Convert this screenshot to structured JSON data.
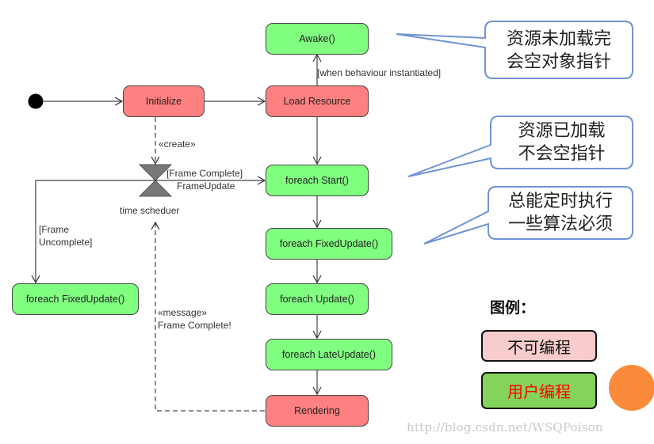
{
  "diagram": {
    "type": "uml-activity",
    "nodes": {
      "awake": "Awake()",
      "load_resource": "Load Resource",
      "initialize": "Initialize",
      "start": "foreach Start()",
      "fixed_update": "foreach FixedUpdate()",
      "update": "foreach Update()",
      "late_update": "foreach LateUpdate()",
      "rendering": "Rendering",
      "fixed_update_loop": "foreach FixedUpdate()"
    },
    "edge_labels": {
      "when_instantiated": "[when behaviour instantiated]",
      "create": "«create»",
      "frame_complete_line1": "[Frame Complete]",
      "frame_complete_line2": "FrameUpdate",
      "frame_uncomplete_line1": "[Frame",
      "frame_uncomplete_line2": "Uncomplete]",
      "message_line1": "«message»",
      "message_line2": "Frame Complete!",
      "time_scheduler": "time scheduer"
    },
    "callouts": [
      {
        "line1": "资源未加载完",
        "line2": "会空对象指针"
      },
      {
        "line1": "资源已加载",
        "line2": "不会空指针"
      },
      {
        "line1": "总能定时执行",
        "line2": "一些算法必须"
      }
    ],
    "legend": {
      "title": "图例：",
      "not_programmable": "不可编程",
      "user_programmable": "用户编程"
    },
    "colors": {
      "user_node": "#80ff80",
      "engine_node": "#ff8080",
      "callout_border": "#6f93d6",
      "legend_pink": "#f8cccc",
      "legend_green": "#84d45a",
      "legend_red_text": "#ff0000",
      "orange_dot": "#fb8a3a"
    },
    "watermark": "http://blog.csdn.net/WSQPoison"
  }
}
